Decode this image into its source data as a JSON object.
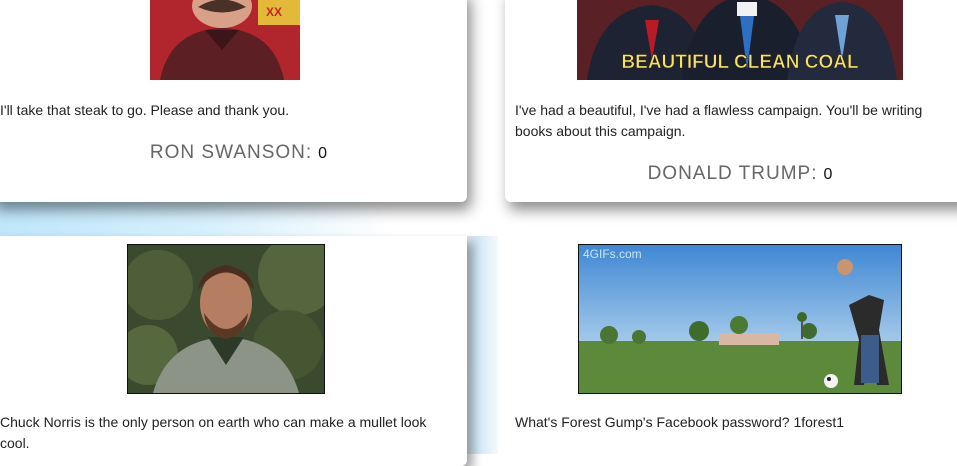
{
  "cards": [
    {
      "quote": "I'll take that steak to go. Please and thank you.",
      "author": "RON SWANSON:",
      "votes": "0",
      "gif_icon": "ron-swanson-gif"
    },
    {
      "quote": "I've had a beautiful, I've had a flawless campaign. You'll be writing books about this campaign.",
      "author": "DONALD TRUMP:",
      "votes": "0",
      "gif_icon": "donald-trump-gif",
      "gif_caption": "BEAUTIFUL CLEAN COAL"
    },
    {
      "quote": "Chuck Norris is the only person on earth who can make a mullet look cool.",
      "gif_icon": "chuck-norris-gif"
    },
    {
      "quote": "What's Forest Gump's Facebook password? 1forest1",
      "gif_icon": "soccer-field-gif",
      "gif_watermark": "4GIFs.com"
    }
  ]
}
